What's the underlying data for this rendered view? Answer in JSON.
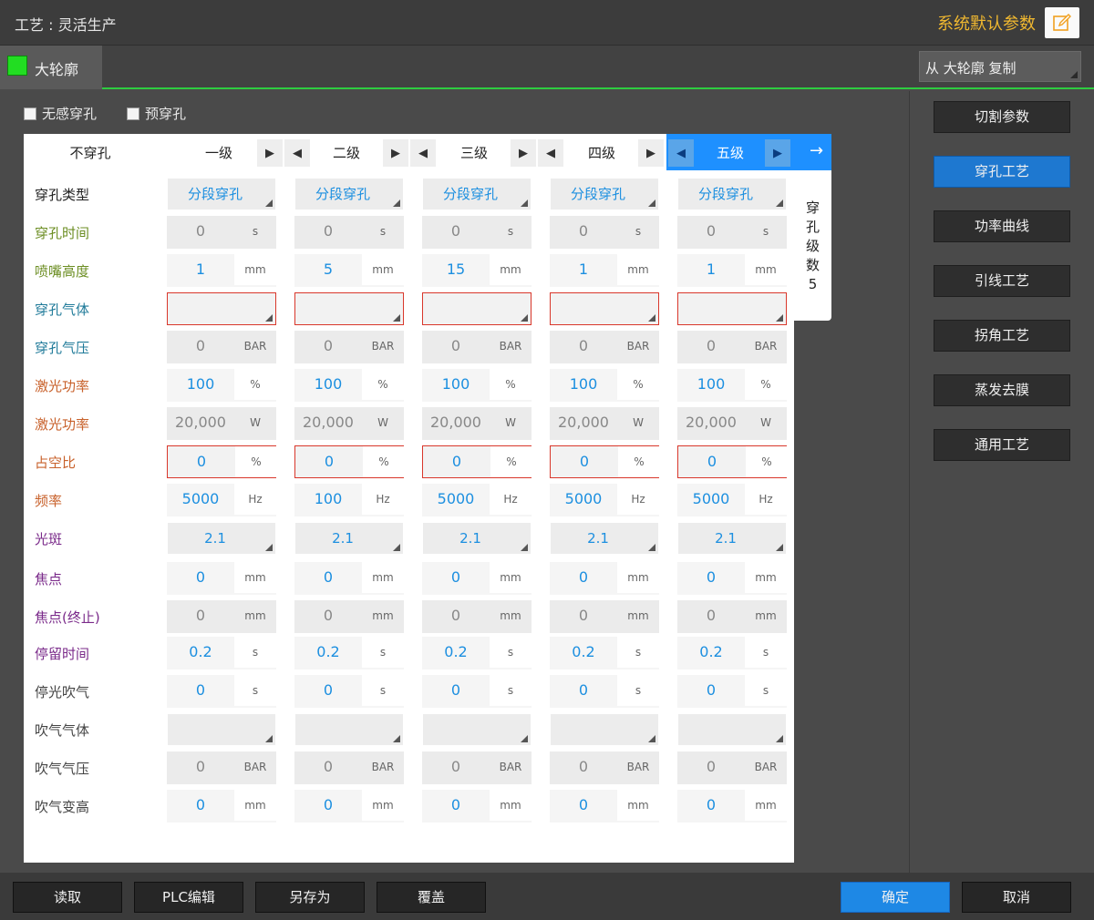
{
  "header": {
    "title": "工艺 : 灵活生产",
    "defaults_label": "系统默认参数"
  },
  "tabbar": {
    "active_tab": "大轮廓",
    "active_color": "#22dd22",
    "copy_select": "从 大轮廓 复制"
  },
  "options": {
    "silent_pierce": "无感穿孔",
    "pre_pierce": "预穿孔"
  },
  "levels": {
    "none": "不穿孔",
    "items": [
      "一级",
      "二级",
      "三级",
      "四级",
      "五级"
    ],
    "active": "五级",
    "go": "→"
  },
  "side_box": {
    "chars": [
      "穿",
      "孔",
      "级",
      "数",
      "5"
    ]
  },
  "rows": [
    {
      "label": "穿孔类型",
      "color": "#222222",
      "type": "select",
      "values": [
        "分段穿孔",
        "分段穿孔",
        "分段穿孔",
        "分段穿孔",
        "分段穿孔"
      ]
    },
    {
      "label": "穿孔时间",
      "color": "#6c8e23",
      "type": "field",
      "style": "grey",
      "unit": "s",
      "values": [
        "0",
        "0",
        "0",
        "0",
        "0"
      ]
    },
    {
      "label": "喷嘴高度",
      "color": "#6c8e23",
      "type": "field",
      "style": "white",
      "unit": "mm",
      "values": [
        "1",
        "5",
        "15",
        "1",
        "1"
      ]
    },
    {
      "label": "穿孔气体",
      "color": "#1f7a99",
      "type": "select-red",
      "values": [
        "",
        "",
        "",
        "",
        ""
      ]
    },
    {
      "label": "穿孔气压",
      "color": "#1f7a99",
      "type": "field",
      "style": "grey",
      "unit": "BAR",
      "values": [
        "0",
        "0",
        "0",
        "0",
        "0"
      ]
    },
    {
      "label": "激光功率",
      "color": "#c8612b",
      "type": "field",
      "style": "white",
      "unit": "%",
      "values": [
        "100",
        "100",
        "100",
        "100",
        "100"
      ]
    },
    {
      "label": "激光功率",
      "color": "#c8612b",
      "type": "field",
      "style": "grey",
      "unit": "W",
      "values": [
        "20,000",
        "20,000",
        "20,000",
        "20,000",
        "20,000"
      ]
    },
    {
      "label": "占空比",
      "color": "#c8612b",
      "type": "field",
      "style": "red",
      "unit": "%",
      "values": [
        "0",
        "0",
        "0",
        "0",
        "0"
      ]
    },
    {
      "label": "频率",
      "color": "#c8612b",
      "type": "field",
      "style": "white",
      "unit": "Hz",
      "values": [
        "5000",
        "100",
        "5000",
        "5000",
        "5000"
      ]
    },
    {
      "label": "光斑",
      "color": "#7a2a8a",
      "type": "select",
      "values": [
        "2.1",
        "2.1",
        "2.1",
        "2.1",
        "2.1"
      ]
    },
    {
      "label": "焦点",
      "color": "#7a2a8a",
      "type": "field",
      "style": "white",
      "unit": "mm",
      "values": [
        "0",
        "0",
        "0",
        "0",
        "0"
      ]
    },
    {
      "label": "焦点(终止)",
      "color": "#7a2a8a",
      "type": "field",
      "style": "grey",
      "unit": "mm",
      "values": [
        "0",
        "0",
        "0",
        "0",
        "0"
      ]
    },
    {
      "label": "停留时间",
      "color": "#7a2a8a",
      "type": "field",
      "style": "white",
      "unit": "s",
      "values": [
        "0.2",
        "0.2",
        "0.2",
        "0.2",
        "0.2"
      ]
    },
    {
      "label": "停光吹气",
      "color": "#444444",
      "type": "field",
      "style": "white",
      "unit": "s",
      "values": [
        "0",
        "0",
        "0",
        "0",
        "0"
      ]
    },
    {
      "label": "吹气气体",
      "color": "#444444",
      "type": "select",
      "values": [
        "",
        "",
        "",
        "",
        ""
      ]
    },
    {
      "label": "吹气气压",
      "color": "#444444",
      "type": "field",
      "style": "grey",
      "unit": "BAR",
      "values": [
        "0",
        "0",
        "0",
        "0",
        "0"
      ]
    },
    {
      "label": "吹气变高",
      "color": "#444444",
      "type": "field",
      "style": "white",
      "unit": "mm",
      "values": [
        "0",
        "0",
        "0",
        "0",
        "0"
      ]
    }
  ],
  "right_nav": [
    "切割参数",
    "穿孔工艺",
    "功率曲线",
    "引线工艺",
    "拐角工艺",
    "蒸发去膜",
    "通用工艺"
  ],
  "right_nav_active": "穿孔工艺",
  "bottom": {
    "read": "读取",
    "plc_edit": "PLC编辑",
    "save_as": "另存为",
    "overwrite": "覆盖",
    "confirm": "确定",
    "cancel": "取消"
  }
}
